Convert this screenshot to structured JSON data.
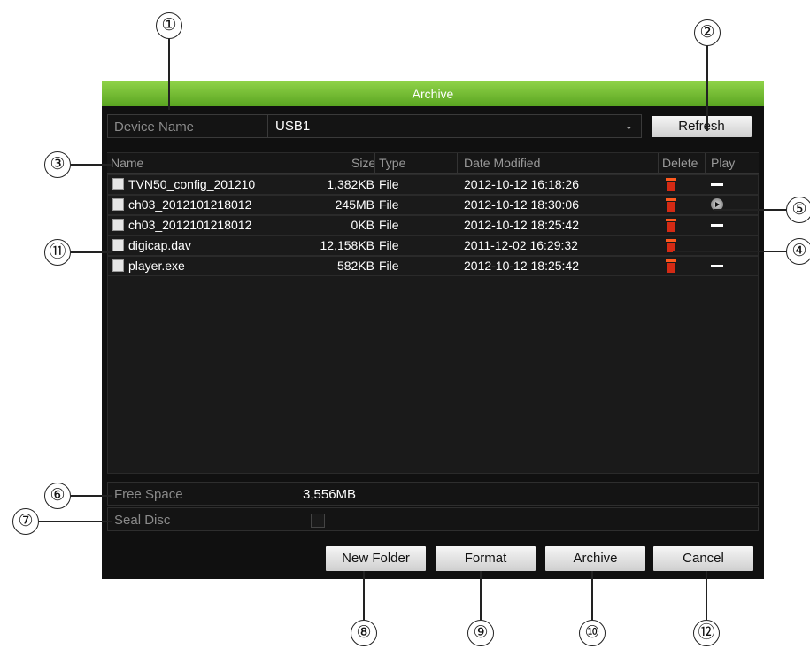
{
  "window": {
    "title": "Archive"
  },
  "device": {
    "label": "Device Name",
    "value": "USB1",
    "refresh_label": "Refresh"
  },
  "table": {
    "columns": [
      "Name",
      "Size",
      "Type",
      "Date Modified",
      "Delete",
      "Play"
    ],
    "rows": [
      {
        "name": "TVN50_config_201210",
        "size": "1,382KB",
        "type": "File",
        "date": "2012-10-12 16:18:26",
        "play": "none"
      },
      {
        "name": "ch03_2012101218012",
        "size": "245MB",
        "type": "File",
        "date": "2012-10-12 18:30:06",
        "play": "play"
      },
      {
        "name": "ch03_2012101218012",
        "size": "0KB",
        "type": "File",
        "date": "2012-10-12 18:25:42",
        "play": "none"
      },
      {
        "name": "digicap.dav",
        "size": "12,158KB",
        "type": "File",
        "date": "2011-12-02 16:29:32",
        "play": "hidden"
      },
      {
        "name": "player.exe",
        "size": "582KB",
        "type": "File",
        "date": "2012-10-12 18:25:42",
        "play": "none"
      }
    ]
  },
  "free_space": {
    "label": "Free Space",
    "value": "3,556MB"
  },
  "seal_disc": {
    "label": "Seal Disc",
    "checked": false
  },
  "buttons": {
    "new_folder": "New Folder",
    "format": "Format",
    "archive": "Archive",
    "cancel": "Cancel"
  },
  "callouts": [
    "①",
    "②",
    "③",
    "④",
    "⑤",
    "⑥",
    "⑦",
    "⑧",
    "⑨",
    "⑩",
    "⑪",
    "⑫"
  ],
  "colors": {
    "titlebar": "#6bb52c",
    "panel": "#101010",
    "delete_icon": "#d42a14"
  },
  "icons": {
    "file": "file-icon",
    "delete": "trash-icon",
    "play": "play-circle-icon",
    "no_play": "dash-icon",
    "dropdown": "chevron-down-icon"
  }
}
